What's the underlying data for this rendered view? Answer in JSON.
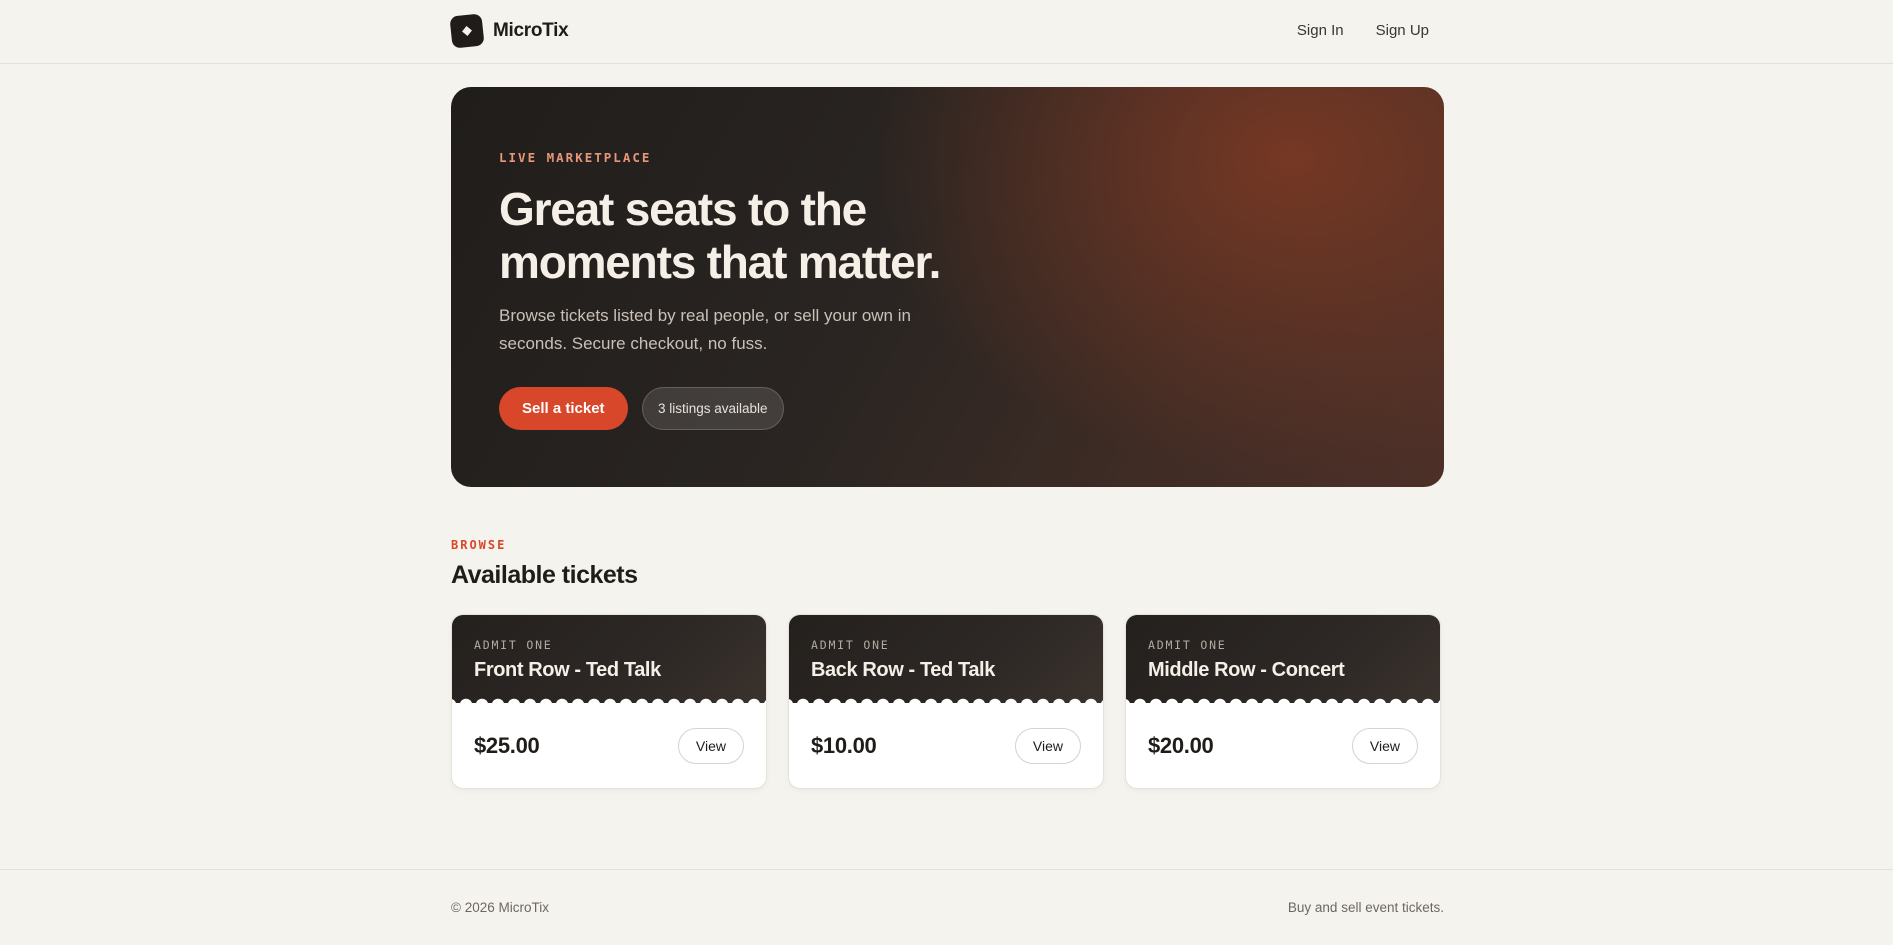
{
  "header": {
    "brand": "MicroTix",
    "nav": {
      "sign_in": "Sign In",
      "sign_up": "Sign Up"
    }
  },
  "hero": {
    "eyebrow": "LIVE MARKETPLACE",
    "title": "Great seats to the moments that matter.",
    "subtitle": "Browse tickets listed by real people, or sell your own in seconds. Secure checkout, no fuss.",
    "sell_button": "Sell a ticket",
    "listings_badge": "3 listings available"
  },
  "browse": {
    "label": "BROWSE",
    "title": "Available tickets",
    "tickets": [
      {
        "admit": "ADMIT ONE",
        "name": "Front Row - Ted Talk",
        "price": "$25.00",
        "action": "View"
      },
      {
        "admit": "ADMIT ONE",
        "name": "Back Row - Ted Talk",
        "price": "$10.00",
        "action": "View"
      },
      {
        "admit": "ADMIT ONE",
        "name": "Middle Row - Concert",
        "price": "$20.00",
        "action": "View"
      }
    ]
  },
  "footer": {
    "copyright": "© 2026 MicroTix",
    "tagline": "Buy and sell event tickets."
  },
  "colors": {
    "accent": "#d9472a",
    "background": "#f5f3ee",
    "dark": "#1f1c1a"
  },
  "icons": {
    "logo": "ticket-logo-icon"
  }
}
